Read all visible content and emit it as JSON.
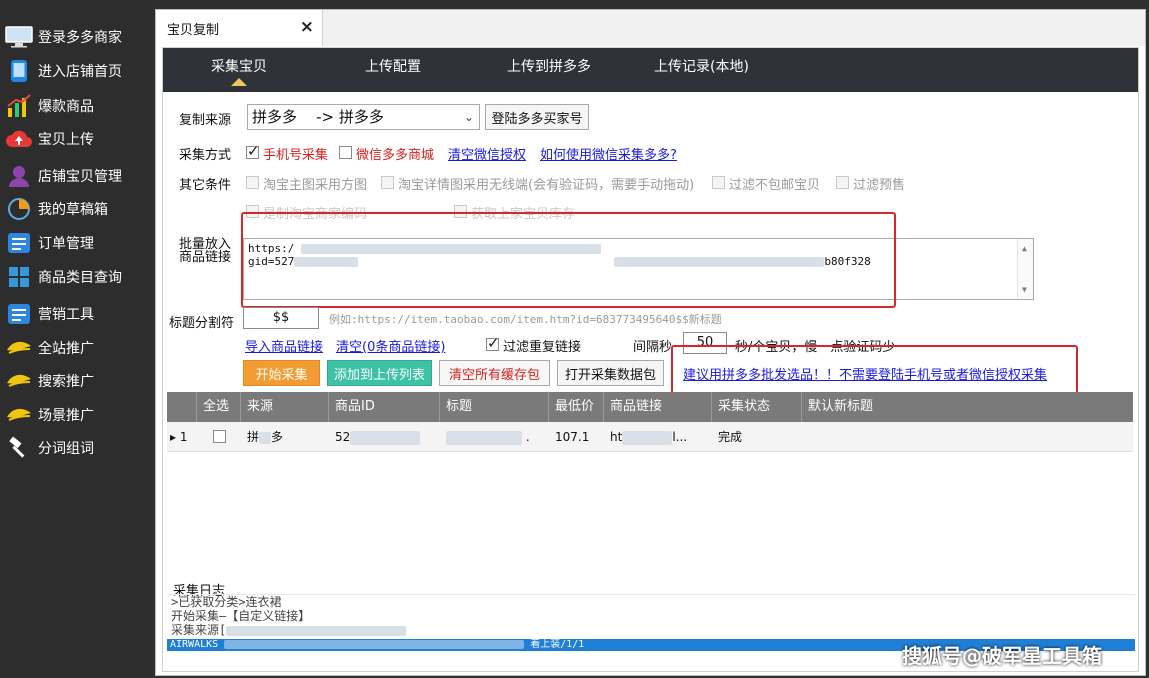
{
  "sidebar": {
    "items": [
      {
        "label": "登录多多商家",
        "icon": "monitor-icon"
      },
      {
        "label": "进入店铺首页",
        "icon": "tablet-icon"
      },
      {
        "label": "爆款商品",
        "icon": "bar-chart-icon"
      },
      {
        "label": "宝贝上传",
        "icon": "cloud-upload-icon"
      },
      {
        "label": "店铺宝贝管理",
        "icon": "user-icon"
      },
      {
        "label": "我的草稿箱",
        "icon": "pie-chart-icon"
      },
      {
        "label": "订单管理",
        "icon": "list-icon"
      },
      {
        "label": "商品类目查询",
        "icon": "grid-icon"
      },
      {
        "label": "营销工具",
        "icon": "list-icon"
      },
      {
        "label": "全站推广",
        "icon": "megaphone-icon"
      },
      {
        "label": "搜索推广",
        "icon": "megaphone-icon"
      },
      {
        "label": "场景推广",
        "icon": "megaphone-icon"
      },
      {
        "label": "分词组词",
        "icon": "hammer-icon"
      }
    ]
  },
  "window": {
    "tab_title": "宝贝复制",
    "close_glyph": "×"
  },
  "subtabs": [
    "采集宝贝",
    "上传配置",
    "上传到拼多多",
    "上传记录(本地)"
  ],
  "form": {
    "source_label": "复制来源",
    "source_value": "拼多多    -> 拼多多",
    "login_button": "登陆多多买家号",
    "method_label": "采集方式",
    "method_phone": "手机号采集",
    "method_wechat": "微信多多商城",
    "clear_wechat_auth": "清空微信授权",
    "how_to_wechat": "如何使用微信采集多多?",
    "other_label": "其它条件",
    "opt_taobao_main": "淘宝主图采用方图",
    "opt_taobao_detail": "淘宝详情图采用无线端(会有验证码，需要手动拖动)",
    "opt_filter_no_ship": "过滤不包邮宝贝",
    "opt_filter_presale": "过滤预售",
    "opt_hidden_1": "是制淘宝商家编码",
    "opt_hidden_2": "获取上家宝贝库存",
    "batch_label_1": "批量放入",
    "batch_label_2": "商品链接",
    "link_line1": "https:/",
    "link_line2": "gid=527",
    "link_tail": "b80f328",
    "title_sep_label": "标题分割符",
    "title_sep_value": "$$",
    "title_sep_hint": "例如:https://item.taobao.com/item.htm?id=683773495640$$新标题",
    "import_links": "导入商品链接",
    "clear_links": "清空(0条商品链接)",
    "filter_dup": "过滤重复链接",
    "interval_label": "间隔秒",
    "interval_value": "50",
    "interval_hint": "秒/个宝贝，慢一点验证码少",
    "start_button": "开始采集",
    "add_upload_button": "添加到上传列表",
    "clear_cache_button": "清空所有缓存包",
    "open_pack_button": "打开采集数据包",
    "suggest_link": "建议用拼多多批发选品！！不需要登陆手机号或者微信授权采集"
  },
  "table": {
    "headers": [
      "全选",
      "来源",
      "商品ID",
      "标题",
      "最低价",
      "商品链接",
      "采集状态",
      "默认新标题"
    ],
    "rows": [
      {
        "index": "1",
        "source": "拼",
        "source_tail": "多",
        "id": "52",
        "title_tail": ".",
        "price": "107.1",
        "link": "ht",
        "link_tail": "l...",
        "status": "完成",
        "new_title": ""
      }
    ]
  },
  "log": {
    "title": "采集日志",
    "lines": [
      ">已获取分类>连衣裙",
      "开始采集—【自定义链接】",
      "采集来源["
    ],
    "status_left": "AIRWALKS",
    "status_right": "着上装/1/1"
  },
  "watermark": "搜狐号@破军星工具箱"
}
